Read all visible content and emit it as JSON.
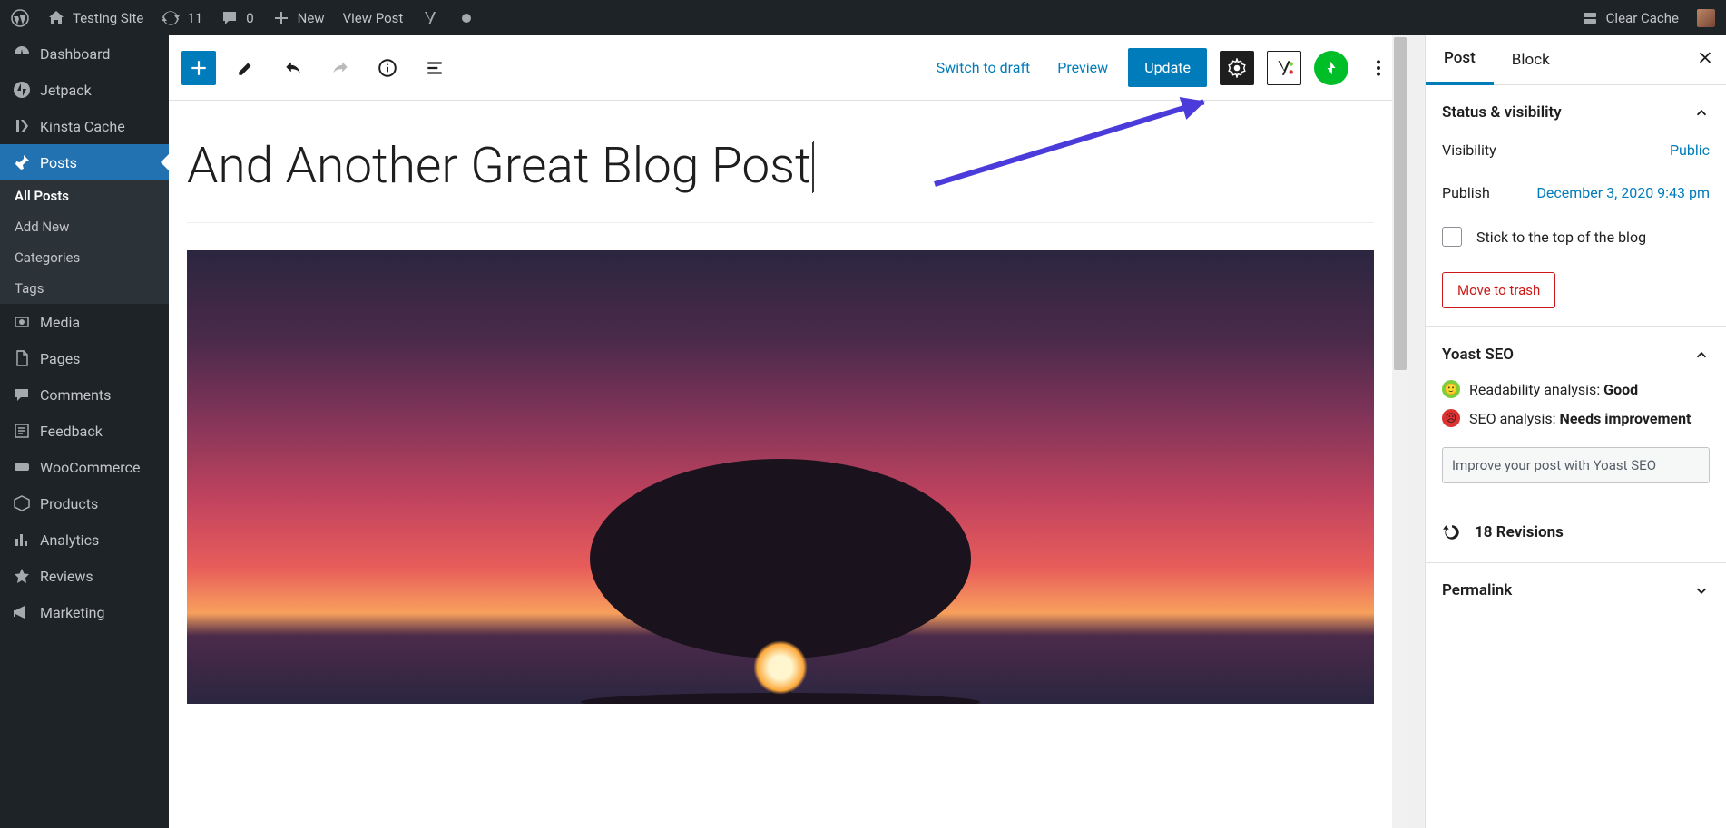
{
  "adminbar": {
    "site_title": "Testing Site",
    "updates_count": "11",
    "comments_count": "0",
    "new_label": "New",
    "view_post_label": "View Post",
    "clear_cache_label": "Clear Cache"
  },
  "sidebar": {
    "items": [
      {
        "label": "Dashboard",
        "icon": "dashboard"
      },
      {
        "label": "Jetpack",
        "icon": "jetpack"
      },
      {
        "label": "Kinsta Cache",
        "icon": "kinsta"
      },
      {
        "label": "Posts",
        "icon": "pin",
        "active": true
      },
      {
        "label": "Media",
        "icon": "media"
      },
      {
        "label": "Pages",
        "icon": "page"
      },
      {
        "label": "Comments",
        "icon": "comment"
      },
      {
        "label": "Feedback",
        "icon": "form"
      },
      {
        "label": "WooCommerce",
        "icon": "woo"
      },
      {
        "label": "Products",
        "icon": "box"
      },
      {
        "label": "Analytics",
        "icon": "bars"
      },
      {
        "label": "Reviews",
        "icon": "star"
      },
      {
        "label": "Marketing",
        "icon": "mega"
      }
    ],
    "submenu": {
      "all_posts": "All Posts",
      "add_new": "Add New",
      "categories": "Categories",
      "tags": "Tags"
    }
  },
  "toolbar": {
    "switch_draft": "Switch to draft",
    "preview": "Preview",
    "update": "Update"
  },
  "post": {
    "title": "And Another Great Blog Post"
  },
  "inspector": {
    "tabs": {
      "post": "Post",
      "block": "Block"
    },
    "status_panel": {
      "title": "Status & visibility",
      "visibility_label": "Visibility",
      "visibility_value": "Public",
      "publish_label": "Publish",
      "publish_value": "December 3, 2020 9:43 pm",
      "sticky_label": "Stick to the top of the blog",
      "trash_label": "Move to trash"
    },
    "yoast_panel": {
      "title": "Yoast SEO",
      "readability_prefix": "Readability analysis: ",
      "readability_value": "Good",
      "seo_prefix": "SEO analysis: ",
      "seo_value": "Needs improvement",
      "improve_button": "Improve your post with Yoast SEO"
    },
    "revisions_label": "18 Revisions",
    "permalink_title": "Permalink"
  }
}
